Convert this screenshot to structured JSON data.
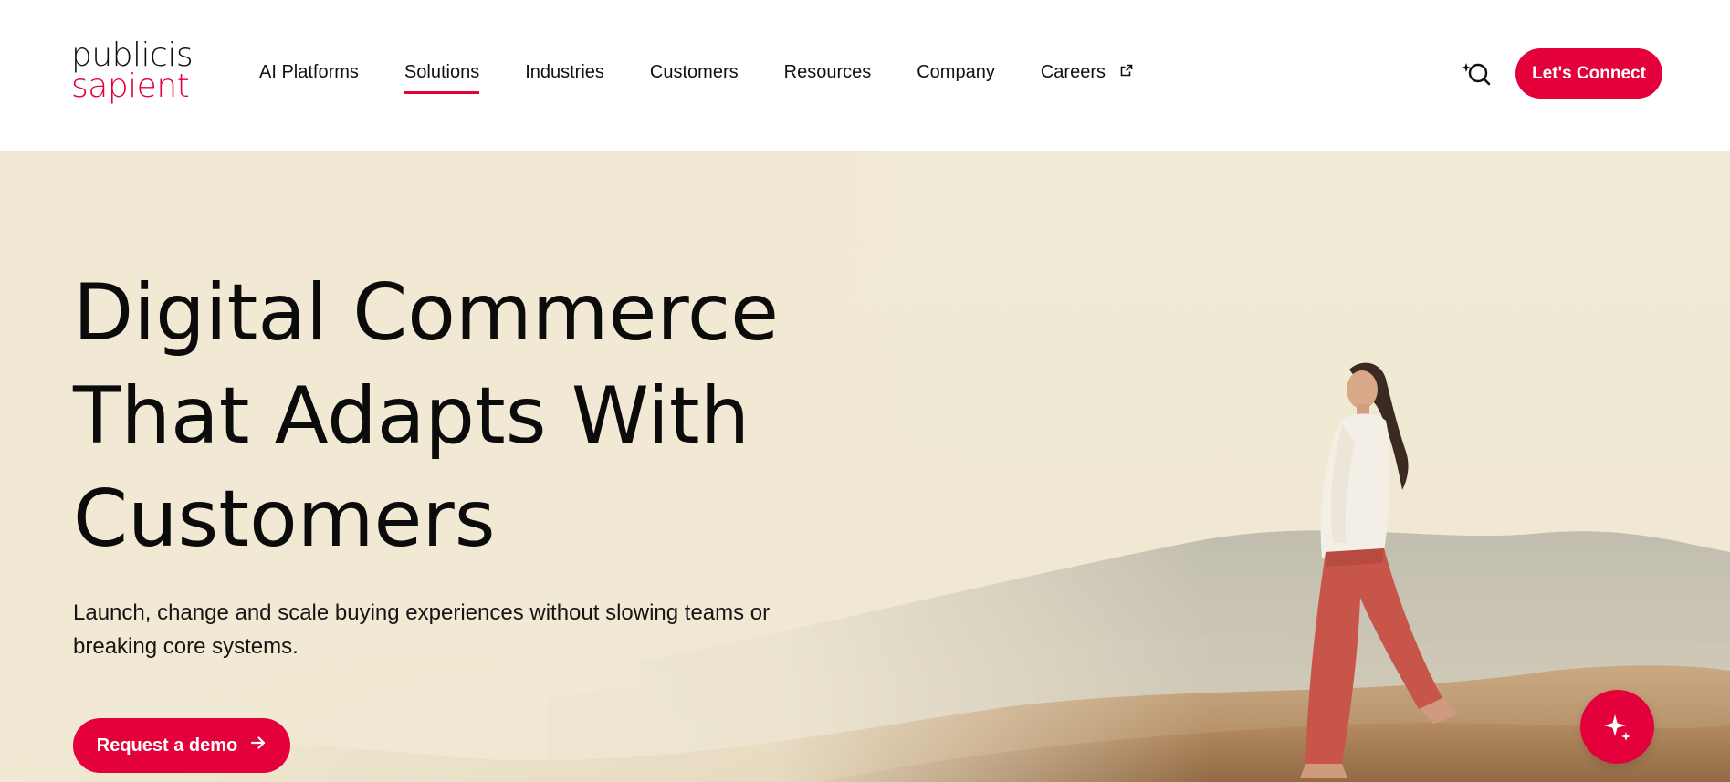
{
  "brand": {
    "logo_line1": "publicis",
    "logo_line2": "sapient",
    "accent_color": "#e4003b"
  },
  "nav": {
    "items": [
      {
        "label": "AI Platforms",
        "active": false
      },
      {
        "label": "Solutions",
        "active": true
      },
      {
        "label": "Industries",
        "active": false
      },
      {
        "label": "Customers",
        "active": false
      },
      {
        "label": "Resources",
        "active": false
      },
      {
        "label": "Company",
        "active": false
      },
      {
        "label": "Careers",
        "active": false,
        "icon": "external-link-icon"
      }
    ]
  },
  "header": {
    "search_icon": "search-sparkle-icon",
    "cta_label": "Let's Connect"
  },
  "hero": {
    "title_line1": "Digital Commerce",
    "title_line2": "That Adapts With",
    "title_line3": "Customers",
    "subtitle_line1": "Launch, change and scale buying experiences without slowing teams or",
    "subtitle_line2": "breaking core systems.",
    "cta_label": "Request a demo",
    "cta_icon": "arrow-right-icon",
    "image": "woman walking across desert dunes with mountains"
  },
  "floating": {
    "ai_icon": "sparkle-icon"
  }
}
